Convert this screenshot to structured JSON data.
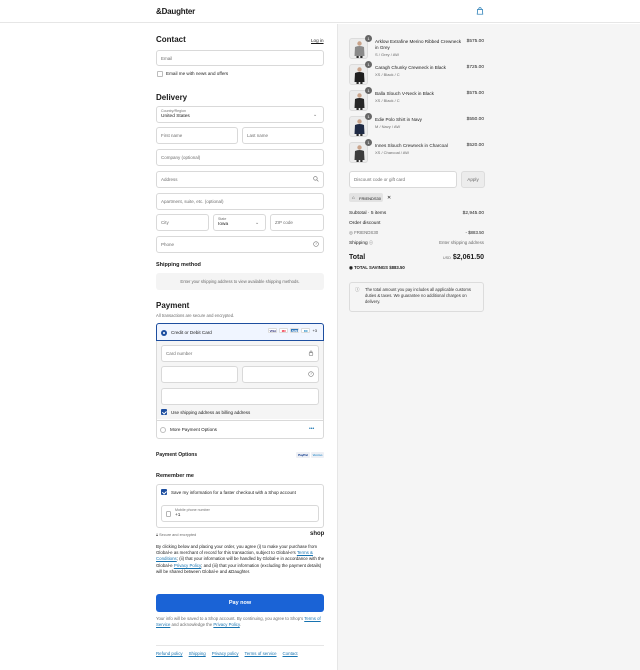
{
  "header": {
    "logo": "&Daughter",
    "bag_icon": "shopping-bag-icon"
  },
  "contact": {
    "title": "Contact",
    "login": "Log in",
    "email_placeholder": "Email",
    "newsletter": "Email me with news and offers"
  },
  "delivery": {
    "title": "Delivery",
    "country_label": "Country/Region",
    "country_value": "United States",
    "first_name": "First name",
    "last_name": "Last name",
    "company": "Company (optional)",
    "address": "Address",
    "apartment": "Apartment, suite, etc. (optional)",
    "city": "City",
    "state_label": "State",
    "state_value": "Iowa",
    "zip": "ZIP code",
    "phone": "Phone"
  },
  "shipping": {
    "title": "Shipping method",
    "notice": "Enter your shipping address to view available shipping methods."
  },
  "payment": {
    "title": "Payment",
    "subtitle": "All transactions are secure and encrypted.",
    "card_option": "Credit or Debit Card",
    "card_brands": [
      "VISA",
      "MC",
      "AMEX",
      "DC",
      "+3"
    ],
    "card_number": "Card number",
    "billing_checkbox": "Use shipping address as billing address",
    "more_options": "More Payment Options",
    "more_icon": "•••"
  },
  "payment_options": {
    "title": "Payment Options",
    "badges": [
      "PayPal",
      "Venmo"
    ]
  },
  "remember": {
    "title": "Remember me",
    "save_info": "Save my information for a faster checkout with a Shop account",
    "mobile_label": "Mobile phone number",
    "mobile_value": "+1",
    "secure": "Secure and encrypted",
    "shop_logo": "shop"
  },
  "legal": {
    "text_1": "By clicking below and placing your order, you agree (i) to make your purchase from Global-e as merchant of record for this transaction, subject to Global-e's",
    "terms": "Terms & Conditions",
    "text_2": "; (ii) that your information will be handled by Global-e in accordance with the Global-e",
    "privacy": "Privacy Policy",
    "text_3": "; and (iii) that your information (excluding the payment details) will be shared between Global-e and &Daughter."
  },
  "pay_button": "Pay now",
  "shop_note": {
    "text_1": "Your info will be saved to a Shop account. By continuing, you agree to Shop's",
    "terms": "Terms of Service",
    "text_2": "and acknowledge the",
    "privacy": "Privacy Policy",
    "text_3": "."
  },
  "footer": [
    "Refund policy",
    "Shipping",
    "Privacy policy",
    "Terms of service",
    "Contact"
  ],
  "cart": {
    "items": [
      {
        "qty": "1",
        "name": "Arklow Extrafine Merino Ribbed Crewneck in Grey",
        "variant": "S / Grey / AW",
        "price": "$575.00",
        "color": "#8a8a8a"
      },
      {
        "qty": "1",
        "name": "Caragh Chunky Crewneck in Black",
        "variant": "XS / Black / C",
        "price": "$725.00",
        "color": "#1e1e1e"
      },
      {
        "qty": "1",
        "name": "Balla Slouch V-Neck in Black",
        "variant": "XS / Black / C",
        "price": "$575.00",
        "color": "#262626"
      },
      {
        "qty": "1",
        "name": "Edie Polo Shirt in Navy",
        "variant": "M / Navy / AW",
        "price": "$550.00",
        "color": "#1f2a44"
      },
      {
        "qty": "1",
        "name": "Innes Slouch Crewneck in Charcoal",
        "variant": "XS / Charcoal / AW",
        "price": "$520.00",
        "color": "#3c3c3c"
      }
    ],
    "discount_placeholder": "Discount code or gift card",
    "apply": "Apply",
    "code_tag": "FRIENDS30",
    "subtotal_label": "Subtotal · 5 items",
    "subtotal_value": "$2,945.00",
    "order_discount_label": "Order discount",
    "discount_code": "FRIENDS30",
    "discount_value": "- $883.50",
    "shipping_label": "Shipping",
    "shipping_value": "Enter shipping address",
    "total_label": "Total",
    "currency": "USD",
    "total_value": "$2,061.50",
    "savings_label": "TOTAL SAVINGS",
    "savings_value": "$883.50",
    "duties_note": "The total amount you pay includes all applicable customs duties & taxes. We guarantee no additional charges on delivery."
  }
}
